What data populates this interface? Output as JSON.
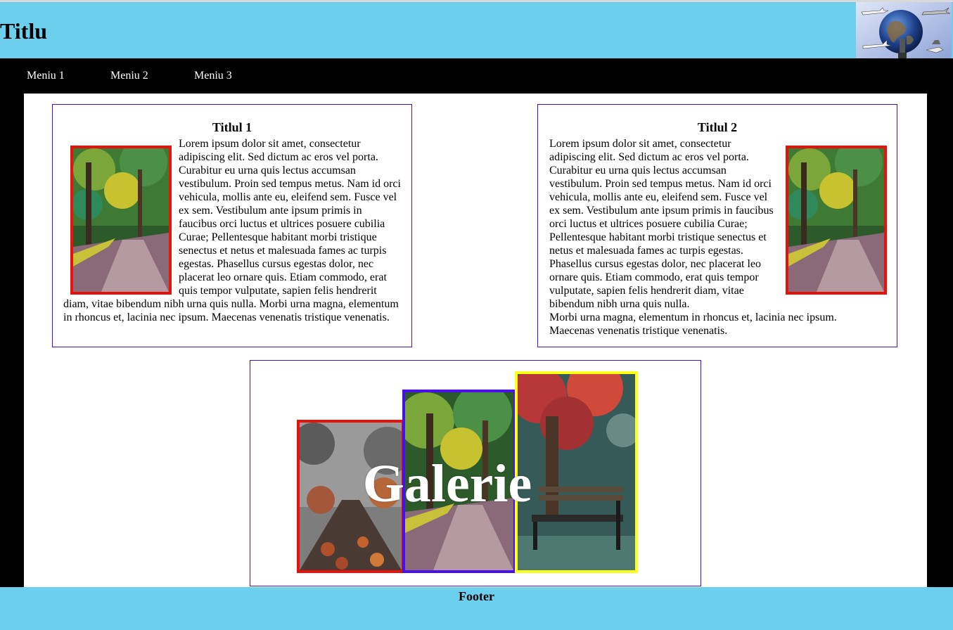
{
  "header": {
    "title": "Titlu"
  },
  "nav": {
    "items": [
      "Meniu 1",
      "Meniu 2",
      "Meniu 3"
    ]
  },
  "articles": [
    {
      "title": "Titlul 1",
      "image_side": "left",
      "text": "Lorem ipsum dolor sit amet, consectetur adipiscing elit. Sed dictum ac eros vel porta. Curabitur eu urna quis lectus accumsan vestibulum. Proin sed tempus metus. Nam id orci vehicula, mollis ante eu, eleifend sem. Fusce vel ex sem. Vestibulum ante ipsum primis in faucibus orci luctus et ultrices posuere cubilia Curae; Pellentesque habitant morbi tristique senectus et netus et malesuada fames ac turpis egestas. Phasellus cursus egestas dolor, nec placerat leo ornare quis. Etiam commodo, erat quis tempor vulputate, sapien felis hendrerit diam, vitae bibendum nibh urna quis nulla. Morbi urna magna, elementum in rhoncus et, lacinia nec ipsum. Maecenas venenatis tristique venenatis."
    },
    {
      "title": "Titlul 2",
      "image_side": "right",
      "text": "Lorem ipsum dolor sit amet, consectetur adipiscing elit. Sed dictum ac eros vel porta. Curabitur eu urna quis lectus accumsan vestibulum. Proin sed tempus metus. Nam id orci vehicula, mollis ante eu, eleifend sem. Fusce vel ex sem. Vestibulum ante ipsum primis in faucibus orci luctus et ultrices posuere cubilia Curae; Pellentesque habitant morbi tristique senectus et netus et malesuada fames ac turpis egestas. Phasellus cursus egestas dolor, nec placerat leo ornare quis. Etiam commodo, erat quis tempor vulputate, sapien felis hendrerit diam, vitae bibendum nibh urna quis nulla.",
      "text_tail_line1": "Morbi urna magna, elementum in rhoncus et, lacinia nec ipsum.",
      "text_tail_line2": "Maecenas venenatis tristique venenatis."
    }
  ],
  "gallery": {
    "title": "Galerie",
    "frame_colors": [
      "#e8120c",
      "#4a10e9",
      "#ffff1a"
    ]
  },
  "footer": {
    "label": "Footer"
  },
  "colors": {
    "header_bg": "#6dcfee",
    "nav_bg": "#000000",
    "article_border": "#4a10c9",
    "image_border": "#e8120c"
  }
}
